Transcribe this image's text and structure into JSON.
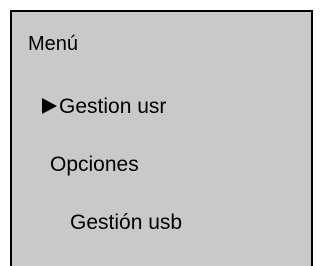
{
  "menu": {
    "title": "Menú",
    "selected_icon": "pointer-icon",
    "items": [
      {
        "label": "Gestion usr",
        "selected": true
      },
      {
        "label": "Opciones",
        "selected": false
      },
      {
        "label": "Gestión usb",
        "selected": false
      }
    ]
  },
  "colors": {
    "panel_background": "#c9c9c9",
    "text": "#000000",
    "border": "#000000"
  }
}
